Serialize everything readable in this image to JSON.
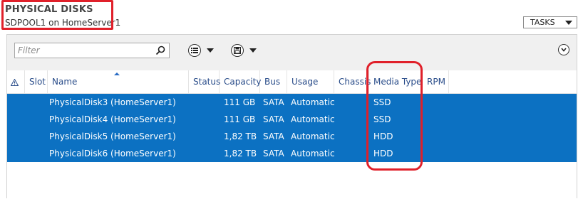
{
  "header": {
    "title": "PHYSICAL DISKS",
    "subtitle": "SDPOOL1 on HomeServer1",
    "tasks_label": "TASKS"
  },
  "toolbar": {
    "filter_placeholder": "Filter",
    "icons": [
      "search-icon",
      "list-view-icon",
      "save-icon",
      "expand-icon"
    ]
  },
  "table": {
    "columns": [
      "",
      "Slot",
      "Name",
      "Status",
      "Capacity",
      "Bus",
      "Usage",
      "Chassis",
      "Media Type",
      "RPM"
    ],
    "rows": [
      {
        "name": "PhysicalDisk3 (HomeServer1)",
        "capacity": "111 GB",
        "bus": "SATA",
        "usage": "Automatic",
        "media": "SSD"
      },
      {
        "name": "PhysicalDisk4 (HomeServer1)",
        "capacity": "111 GB",
        "bus": "SATA",
        "usage": "Automatic",
        "media": "SSD"
      },
      {
        "name": "PhysicalDisk5 (HomeServer1)",
        "capacity": "1,82 TB",
        "bus": "SATA",
        "usage": "Automatic",
        "media": "HDD"
      },
      {
        "name": "PhysicalDisk6 (HomeServer1)",
        "capacity": "1,82 TB",
        "bus": "SATA",
        "usage": "Automatic",
        "media": "HDD"
      }
    ]
  },
  "colors": {
    "selection": "#0c71c2",
    "highlight": "#e0202a",
    "header_text": "#2a4d8a"
  }
}
